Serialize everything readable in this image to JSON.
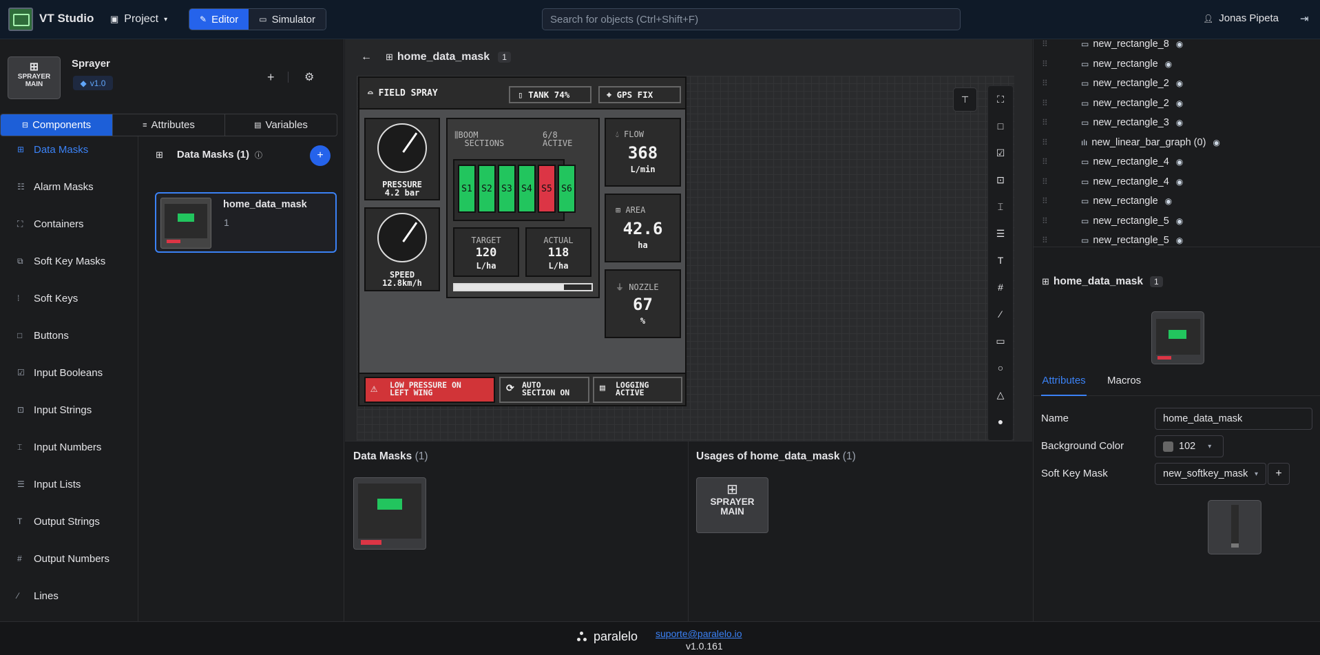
{
  "app": {
    "title": "VT Studio",
    "project_menu": "Project",
    "mode_editor": "Editor",
    "mode_simulator": "Simulator",
    "search_placeholder": "Search for objects (Ctrl+Shift+F)",
    "user": "Jonas Pipeta"
  },
  "project": {
    "icon_line1": "SPRAYER",
    "icon_line2": "MAIN",
    "name": "Sprayer",
    "version": "v1.0"
  },
  "left_tabs": [
    "Components",
    "Attributes",
    "Variables"
  ],
  "side_items": [
    "Data Masks",
    "Alarm Masks",
    "Containers",
    "Soft Key Masks",
    "Soft Keys",
    "Buttons",
    "Input Booleans",
    "Input Strings",
    "Input Numbers",
    "Input Lists",
    "Output Strings",
    "Output Numbers",
    "Lines"
  ],
  "list_header": {
    "title": "Data Masks (1)"
  },
  "list_card": {
    "name": "home_data_mask",
    "count": "1"
  },
  "editor": {
    "title": "home_data_mask",
    "badge": "1"
  },
  "mask": {
    "header_title": "FIELD SPRAY",
    "tank": "TANK 74%",
    "gps": "GPS FIX",
    "pressure_label": "PRESSURE",
    "pressure_value": "4.2 bar",
    "speed_label": "SPEED",
    "speed_value": "12.8km/h",
    "boom_line1": "BOOM",
    "boom_line2": "SECTIONS",
    "active_line1": "6/8",
    "active_line2": "ACTIVE",
    "sections": [
      {
        "label": "S1",
        "color": "#22c55e"
      },
      {
        "label": "S2",
        "color": "#22c55e"
      },
      {
        "label": "S3",
        "color": "#22c55e"
      },
      {
        "label": "S4",
        "color": "#22c55e"
      },
      {
        "label": "S5",
        "color": "#dc3545"
      },
      {
        "label": "S6",
        "color": "#22c55e"
      }
    ],
    "target_label": "TARGET",
    "target_value": "120",
    "target_unit": "L/ha",
    "actual_label": "ACTUAL",
    "actual_value": "118",
    "actual_unit": "L/ha",
    "progress_fraction": 0.8,
    "flow_label": "FLOW",
    "flow_value": "368",
    "flow_unit": "L/min",
    "area_label": "AREA",
    "area_value": "42.6",
    "area_unit": "ha",
    "nozzle_label": "NOZZLE",
    "nozzle_value": "67",
    "nozzle_unit": "%",
    "alarm_line1": "LOW PRESSURE ON",
    "alarm_line2": "LEFT WING",
    "auto_line1": "AUTO",
    "auto_line2": "SECTION ON",
    "log_line1": "LOGGING",
    "log_line2": "ACTIVE"
  },
  "bottom": {
    "masks_title": "Data Masks",
    "masks_count": "(1)",
    "usages_title": "Usages of home_data_mask",
    "usages_count": "(1)",
    "usage_line1": "SPRAYER",
    "usage_line2": "MAIN"
  },
  "tree": [
    "new_rectangle_8",
    "new_rectangle",
    "new_rectangle_2",
    "new_rectangle_2",
    "new_rectangle_3",
    "new_linear_bar_graph (0)",
    "new_rectangle_4",
    "new_rectangle_4",
    "new_rectangle",
    "new_rectangle_5",
    "new_rectangle_5"
  ],
  "props": {
    "title": "home_data_mask",
    "badge": "1",
    "tab_attributes": "Attributes",
    "tab_macros": "Macros",
    "name_label": "Name",
    "name_value": "home_data_mask",
    "bg_label": "Background Color",
    "bg_value": "102",
    "skm_label": "Soft Key Mask",
    "skm_value": "new_softkey_mask"
  },
  "footer": {
    "brand": "paralelo",
    "email": "suporte@paralelo.io",
    "version": "v1.0.161"
  }
}
